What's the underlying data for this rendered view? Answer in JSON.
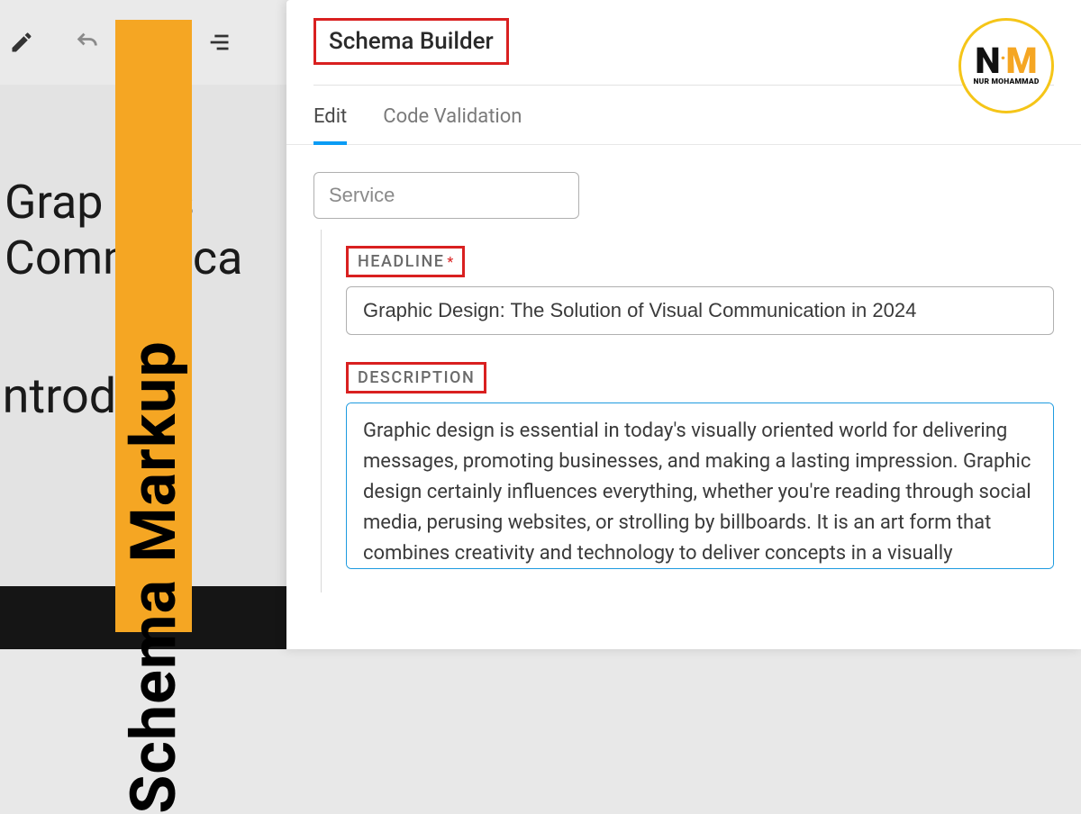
{
  "overlay": {
    "badge_text": "Schema Markup"
  },
  "background": {
    "title_line1": "Grap      Des",
    "title_line2": "Commu    ica",
    "subtitle": "Introdu"
  },
  "panel": {
    "title": "Schema Builder",
    "tabs": [
      {
        "label": "Edit",
        "active": true
      },
      {
        "label": "Code Validation",
        "active": false
      }
    ],
    "type_value": "Service",
    "fields": {
      "headline": {
        "label": "HEADLINE",
        "required": true,
        "value": "Graphic Design: The Solution of Visual Communication in 2024"
      },
      "description": {
        "label": "DESCRIPTION",
        "required": false,
        "value": "Graphic design is essential in today's visually oriented world for delivering messages, promoting businesses, and making a lasting impression. Graphic design certainly influences everything, whether you're reading through social media, perusing websites, or strolling by billboards. It is an art form that combines creativity and technology to deliver concepts in a visually appealing way. In this essay, we will go"
      }
    }
  },
  "logo": {
    "initials_n": "N",
    "initials_m": "M",
    "name": "NUR MOHAMMAD"
  }
}
